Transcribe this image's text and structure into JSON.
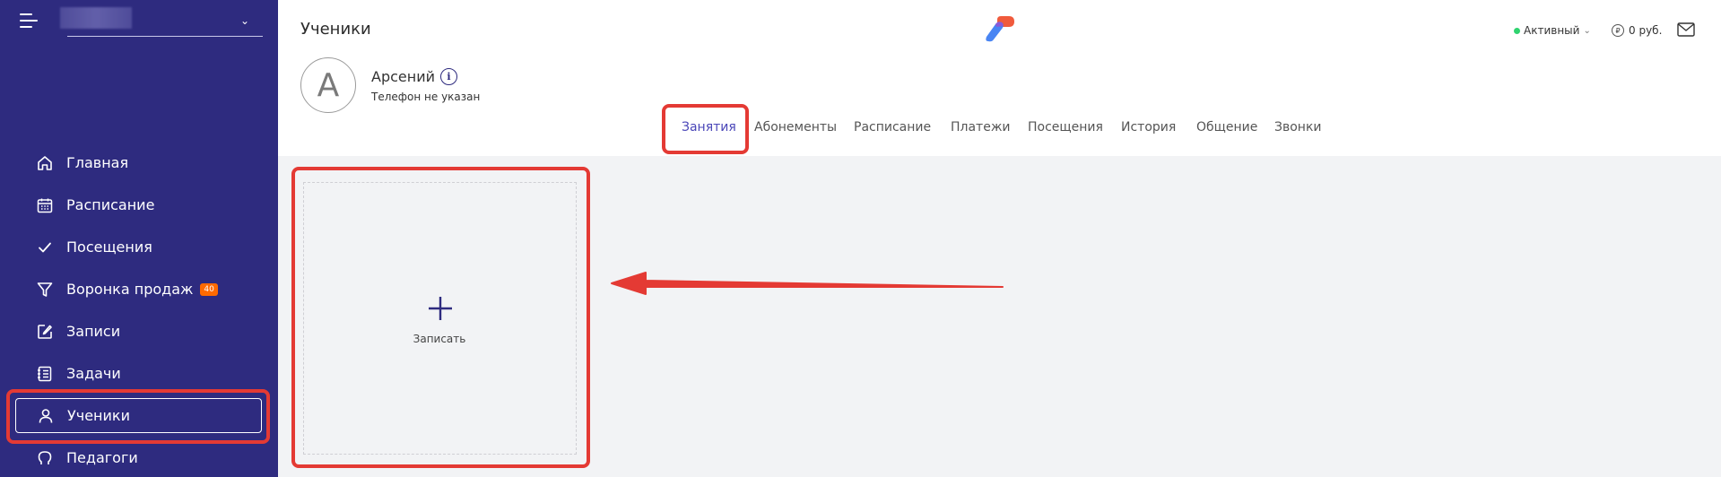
{
  "sidebar": {
    "items": [
      {
        "label": "Главная",
        "icon": "home-icon"
      },
      {
        "label": "Расписание",
        "icon": "calendar-icon"
      },
      {
        "label": "Посещения",
        "icon": "check-icon"
      },
      {
        "label": "Воронка продаж",
        "icon": "funnel-icon",
        "badge": "40"
      },
      {
        "label": "Записи",
        "icon": "edit-icon"
      },
      {
        "label": "Задачи",
        "icon": "checklist-icon"
      },
      {
        "label": "Ученики",
        "icon": "user-icon",
        "active": true
      },
      {
        "label": "Педагоги",
        "icon": "teacher-icon"
      }
    ]
  },
  "header": {
    "title": "Ученики",
    "status": "Активный",
    "balance": "0 руб."
  },
  "student": {
    "initial": "А",
    "name": "Арсений",
    "phone": "Телефон не указан"
  },
  "tabs": [
    {
      "label": "Занятия",
      "active": true
    },
    {
      "label": "Абонементы"
    },
    {
      "label": "Расписание"
    },
    {
      "label": "Платежи"
    },
    {
      "label": "Посещения"
    },
    {
      "label": "История"
    },
    {
      "label": "Общение"
    },
    {
      "label": "Звонки"
    }
  ],
  "main": {
    "add_label": "Записать"
  },
  "colors": {
    "sidebar_bg": "#2e2b7f",
    "accent": "#4a46b8",
    "highlight": "#e43a34",
    "badge": "#ff6a00",
    "status_active": "#2fd36f"
  }
}
